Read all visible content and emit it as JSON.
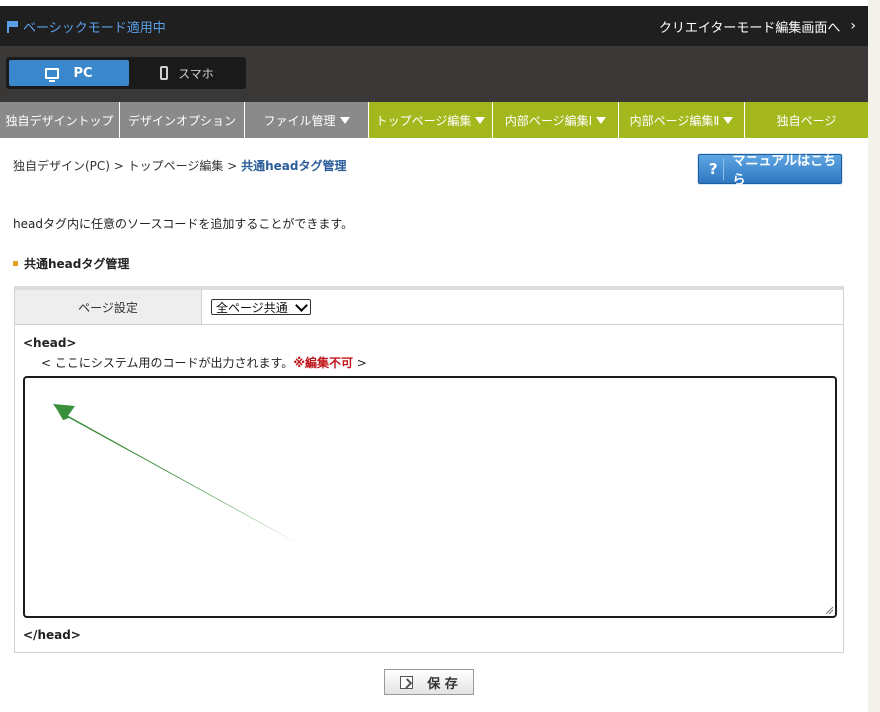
{
  "modebar": {
    "mode_status": "ベーシックモード適用中",
    "creator_link": "クリエイターモード編集画面へ",
    "chevron": "›"
  },
  "device": {
    "pc_label": "PC",
    "sp_label": "スマホ"
  },
  "nav": {
    "items": [
      {
        "label": "独自デザイントップ"
      },
      {
        "label": "デザインオプション"
      },
      {
        "label": "ファイル管理"
      },
      {
        "label": "トップページ編集"
      },
      {
        "label": "内部ページ編集Ⅰ"
      },
      {
        "label": "内部ページ編集Ⅱ"
      },
      {
        "label": "独自ページ"
      }
    ]
  },
  "breadcrumb": {
    "path": "独自デザイン(PC) > トップページ編集 > ",
    "current": "共通headタグ管理"
  },
  "manual_button": {
    "icon": "?",
    "label": "マニュアルはこちら"
  },
  "intro_text": "headタグ内に任意のソースコードを追加することができます。",
  "section_title": "共通headタグ管理",
  "panel": {
    "setting_label": "ページ設定",
    "page_select_value": "全ページ共通",
    "head_open": "<head>",
    "notice_prefix": "< ここにシステム用のコードが出力されます。",
    "notice_warning": "※編集不可",
    "notice_suffix": " >",
    "head_close": "</head>"
  },
  "save_button": {
    "label": "保 存"
  },
  "colors": {
    "accent_blue": "#3b87cc",
    "nav_green": "#a4b81e",
    "nav_gray": "#8a8a8a",
    "warning_red": "#c0151b",
    "annotation_arrow_green": "#3a8f3a"
  }
}
